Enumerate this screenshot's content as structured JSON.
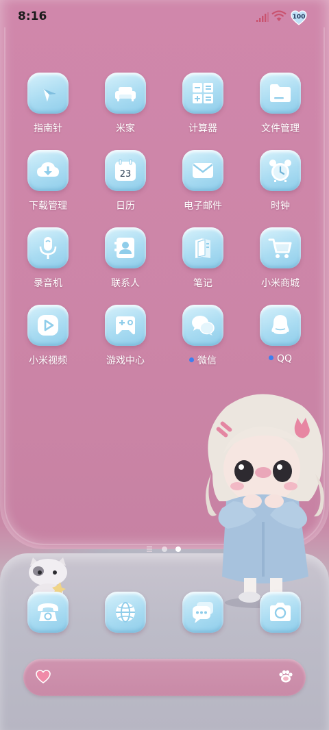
{
  "status_bar": {
    "time": "8:16",
    "battery": "100",
    "signal_icon": "signal-icon",
    "wifi_icon": "wifi-icon"
  },
  "apps": [
    {
      "label": "指南针",
      "icon": "compass-icon",
      "dot": false
    },
    {
      "label": "米家",
      "icon": "sofa-icon",
      "dot": false
    },
    {
      "label": "计算器",
      "icon": "calculator-icon",
      "dot": false
    },
    {
      "label": "文件管理",
      "icon": "folder-icon",
      "dot": false
    },
    {
      "label": "下载管理",
      "icon": "download-icon",
      "dot": false
    },
    {
      "label": "日历",
      "icon": "calendar-icon",
      "dot": false,
      "glyph": "23"
    },
    {
      "label": "电子邮件",
      "icon": "mail-icon",
      "dot": false
    },
    {
      "label": "时钟",
      "icon": "alarm-clock-icon",
      "dot": false
    },
    {
      "label": "录音机",
      "icon": "microphone-icon",
      "dot": false
    },
    {
      "label": "联系人",
      "icon": "contact-card-icon",
      "dot": false
    },
    {
      "label": "笔记",
      "icon": "notes-icon",
      "dot": false
    },
    {
      "label": "小米商城",
      "icon": "shopping-cart-icon",
      "dot": false
    },
    {
      "label": "小米视频",
      "icon": "play-icon",
      "dot": false
    },
    {
      "label": "游戏中心",
      "icon": "gamepad-icon",
      "dot": false
    },
    {
      "label": "微信",
      "icon": "chat-bubbles-icon",
      "dot": true
    },
    {
      "label": "QQ",
      "icon": "qq-penguin-icon",
      "dot": true
    }
  ],
  "dock": [
    {
      "icon": "phone-icon"
    },
    {
      "icon": "browser-globe-icon"
    },
    {
      "icon": "messages-icon"
    },
    {
      "icon": "camera-icon"
    }
  ],
  "page_indicator": {
    "pages": 2,
    "current": 2
  },
  "search_bar": {
    "left_icon": "heart-icon",
    "right_icon": "paw-icon"
  },
  "colors": {
    "icon_blue": "#a8dbf1",
    "icon_glyph": "#ffffff",
    "wallpaper_pink": "#cd88a8",
    "notify_dot": "#3d7ff0"
  }
}
